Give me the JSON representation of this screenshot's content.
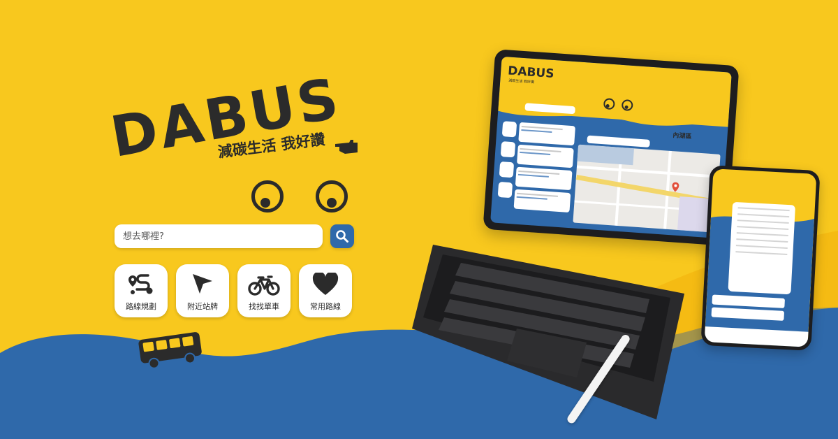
{
  "brand": {
    "name": "DABUS",
    "tagline": "減碳生活 我好讚"
  },
  "search": {
    "placeholder": "想去哪裡?"
  },
  "menu": [
    {
      "label": "路線規劃",
      "icon": "route-icon"
    },
    {
      "label": "附近站牌",
      "icon": "location-arrow-icon"
    },
    {
      "label": "找找單車",
      "icon": "bicycle-icon"
    },
    {
      "label": "常用路線",
      "icon": "heart-icon"
    }
  ],
  "tablet": {
    "logo": "DABUS",
    "subtitle": "減碳生活 我好讚",
    "district": "內湖區"
  },
  "colors": {
    "yellow": "#F8C81E",
    "blue": "#2F69AA",
    "dark": "#2b2b2b"
  }
}
